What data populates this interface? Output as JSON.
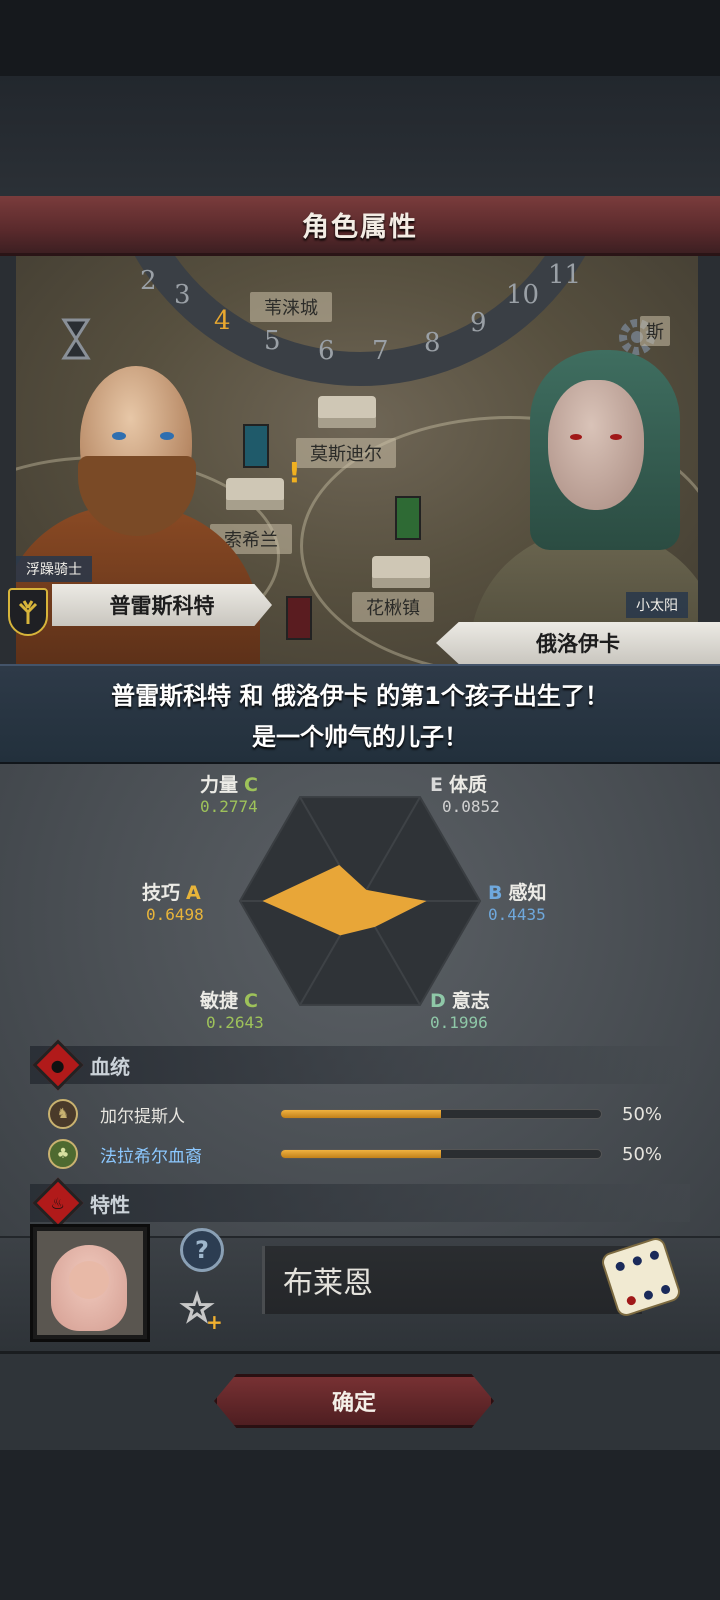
{
  "header": {
    "title": "角色属性"
  },
  "map": {
    "dial_numbers": [
      "2",
      "3",
      "4",
      "5",
      "6",
      "7",
      "8",
      "9",
      "10",
      "11"
    ],
    "dial_active": "4",
    "towns": [
      "苇涞城",
      "莫斯迪尔",
      "索希兰",
      "花楸镇",
      "斯"
    ]
  },
  "father": {
    "title": "浮躁骑士",
    "name": "普雷斯科特"
  },
  "mother": {
    "title": "小太阳",
    "name": "俄洛伊卡"
  },
  "announcement": {
    "line1": "普雷斯科特 和 俄洛伊卡 的第1个孩子出生了！",
    "line2": "是一个帅气的儿子！"
  },
  "stats": {
    "strength": {
      "label": "力量",
      "grade": "C",
      "value": "0.2774",
      "color": "#9ec25a"
    },
    "constitution": {
      "label": "体质",
      "grade": "E",
      "value": "0.0852",
      "color": "#d8d8d8"
    },
    "skill": {
      "label": "技巧",
      "grade": "A",
      "value": "0.6498",
      "color": "#e8b43a"
    },
    "perception": {
      "label": "感知",
      "grade": "B",
      "value": "0.4435",
      "color": "#6fa8dc"
    },
    "agility": {
      "label": "敏捷",
      "grade": "C",
      "value": "0.2643",
      "color": "#9ec25a"
    },
    "will": {
      "label": "意志",
      "grade": "D",
      "value": "0.1996",
      "color": "#8fc8a8"
    }
  },
  "radar_values": [
    0.2774,
    0.0852,
    0.4435,
    0.1996,
    0.2643,
    0.6498
  ],
  "bloodline": {
    "title": "血统",
    "items": [
      {
        "name": "加尔提斯人",
        "percent_label": "50%",
        "fraction": 0.5,
        "name_color": "#e6e4de"
      },
      {
        "name": "法拉希尔血裔",
        "percent_label": "50%",
        "fraction": 0.5,
        "name_color": "#8cc8ff"
      }
    ]
  },
  "traits": {
    "title": "特性"
  },
  "child": {
    "name_value": "布莱恩"
  },
  "confirm_label": "确定",
  "icons": [
    "hourglass-icon",
    "gear-icon",
    "tree-crest-icon",
    "help-icon",
    "star-add-icon",
    "dice-icon",
    "blood-drop-icon",
    "fire-icon"
  ]
}
